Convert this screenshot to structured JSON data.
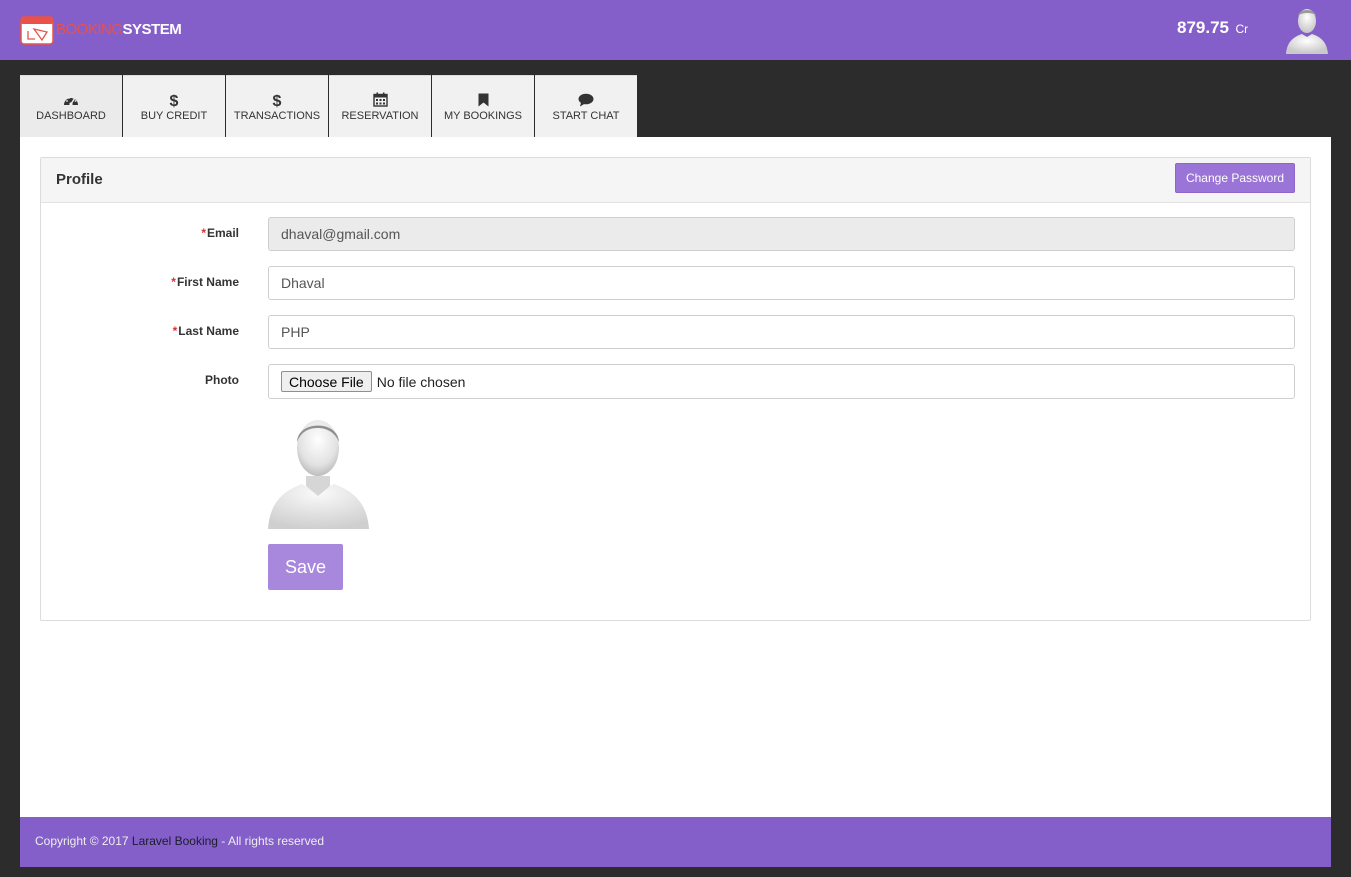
{
  "header": {
    "logo_word1": "BOOKING",
    "logo_word2": "SYSTEM",
    "credit_amount": "879.75",
    "credit_unit": "Cr",
    "avatar_icon": "user-avatar"
  },
  "tabs": [
    {
      "label": "DASHBOARD",
      "icon": "dashboard-icon"
    },
    {
      "label": "BUY CREDIT",
      "icon": "dollar-icon"
    },
    {
      "label": "TRANSACTIONS",
      "icon": "dollar-icon"
    },
    {
      "label": "RESERVATION",
      "icon": "calendar-icon"
    },
    {
      "label": "MY BOOKINGS",
      "icon": "bookmark-icon"
    },
    {
      "label": "START CHAT",
      "icon": "chat-icon"
    }
  ],
  "profile": {
    "title": "Profile",
    "change_password_label": "Change Password",
    "required_marker": "*",
    "email_label": "Email",
    "email_value": "dhaval@gmail.com",
    "first_name_label": "First Name",
    "first_name_value": "Dhaval",
    "last_name_label": "Last Name",
    "last_name_value": "PHP",
    "photo_label": "Photo",
    "choose_file_label": "Choose File",
    "file_status": "No file chosen",
    "save_label": "Save"
  },
  "footer": {
    "prefix": "Copyright © 2017 ",
    "link": "Laravel Booking",
    "suffix": " - All rights reserved"
  },
  "colors": {
    "brand": "#845ec9",
    "button": "#9a74d6",
    "save_button": "#a888dc",
    "page_bg": "#2c2c2c"
  }
}
